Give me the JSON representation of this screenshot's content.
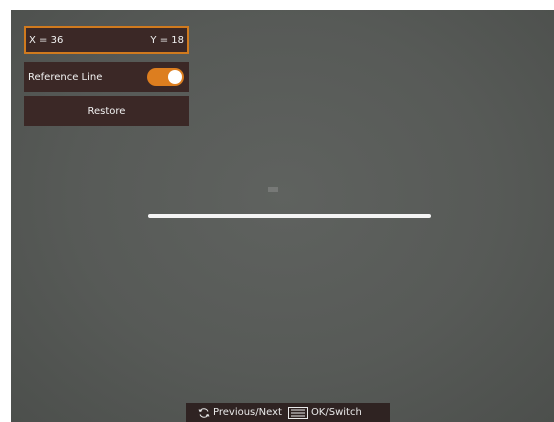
{
  "coords": {
    "x_label": "X = 36",
    "y_label": "Y = 18"
  },
  "reference_line": {
    "label": "Reference Line",
    "enabled": true
  },
  "restore": {
    "label": "Restore"
  },
  "hints": {
    "prev_next": "Previous/Next",
    "ok_switch": "OK/Switch",
    "prev_next_icon": "rotate-icon",
    "ok_switch_icon": "menu-icon"
  },
  "colors": {
    "accent": "#dd7e1f",
    "panel": "#3b2826",
    "background": "#575a57",
    "line": "#f4f4f4"
  }
}
